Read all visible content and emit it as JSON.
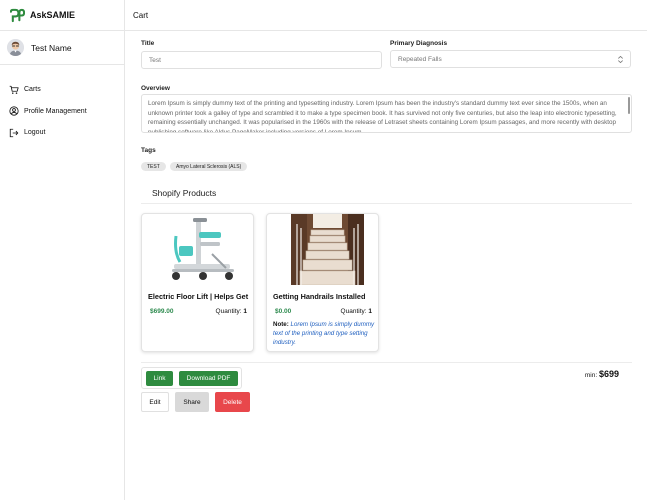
{
  "app": {
    "name": "AskSAMIE",
    "brand_color": "#2e8b3f"
  },
  "user": {
    "name": "Test Name"
  },
  "nav": [
    {
      "label": "Carts",
      "icon": "cart-icon"
    },
    {
      "label": "Profile Management",
      "icon": "user-circle-icon"
    },
    {
      "label": "Logout",
      "icon": "logout-icon"
    }
  ],
  "header": {
    "title": "Cart"
  },
  "form": {
    "title_label": "Title",
    "title_value": "Test",
    "diagnosis_label": "Primary Diagnosis",
    "diagnosis_value": "Repeated Falls",
    "overview_label": "Overview",
    "overview_text": "Lorem Ipsum is simply dummy text of the printing and typesetting industry. Lorem Ipsum has been the industry's standard dummy text ever since the 1500s, when an unknown printer took a galley of type and scrambled it to make a type specimen book. It has survived not only five centuries, but also the leap into electronic typesetting, remaining essentially unchanged. It was popularised in the 1960s with the release of Letraset sheets containing Lorem Ipsum passages, and more recently with desktop publishing software like Aldus PageMaker including versions of Lorem Ipsum.",
    "tags_label": "Tags",
    "tags": [
      "TEST",
      "Amyo Lateral Sclerosis (ALS)"
    ]
  },
  "products_section": {
    "title": "Shopify Products"
  },
  "products": [
    {
      "name": "Electric Floor Lift | Helps Get Up",
      "price": "$699.00",
      "qty_label": "Quantity:",
      "qty": "1",
      "note_label": "",
      "note": ""
    },
    {
      "name": "Getting Handrails Installed",
      "price": "$0.00",
      "qty_label": "Quantity:",
      "qty": "1",
      "note_label": "Note:",
      "note": "Lorem Ipsum is simply dummy text of the printing and type setting industry."
    }
  ],
  "actions": {
    "link": "Link",
    "download": "Download PDF",
    "edit": "Edit",
    "share": "Share",
    "delete": "Delete"
  },
  "total": {
    "label": "min:",
    "value": "$699"
  }
}
